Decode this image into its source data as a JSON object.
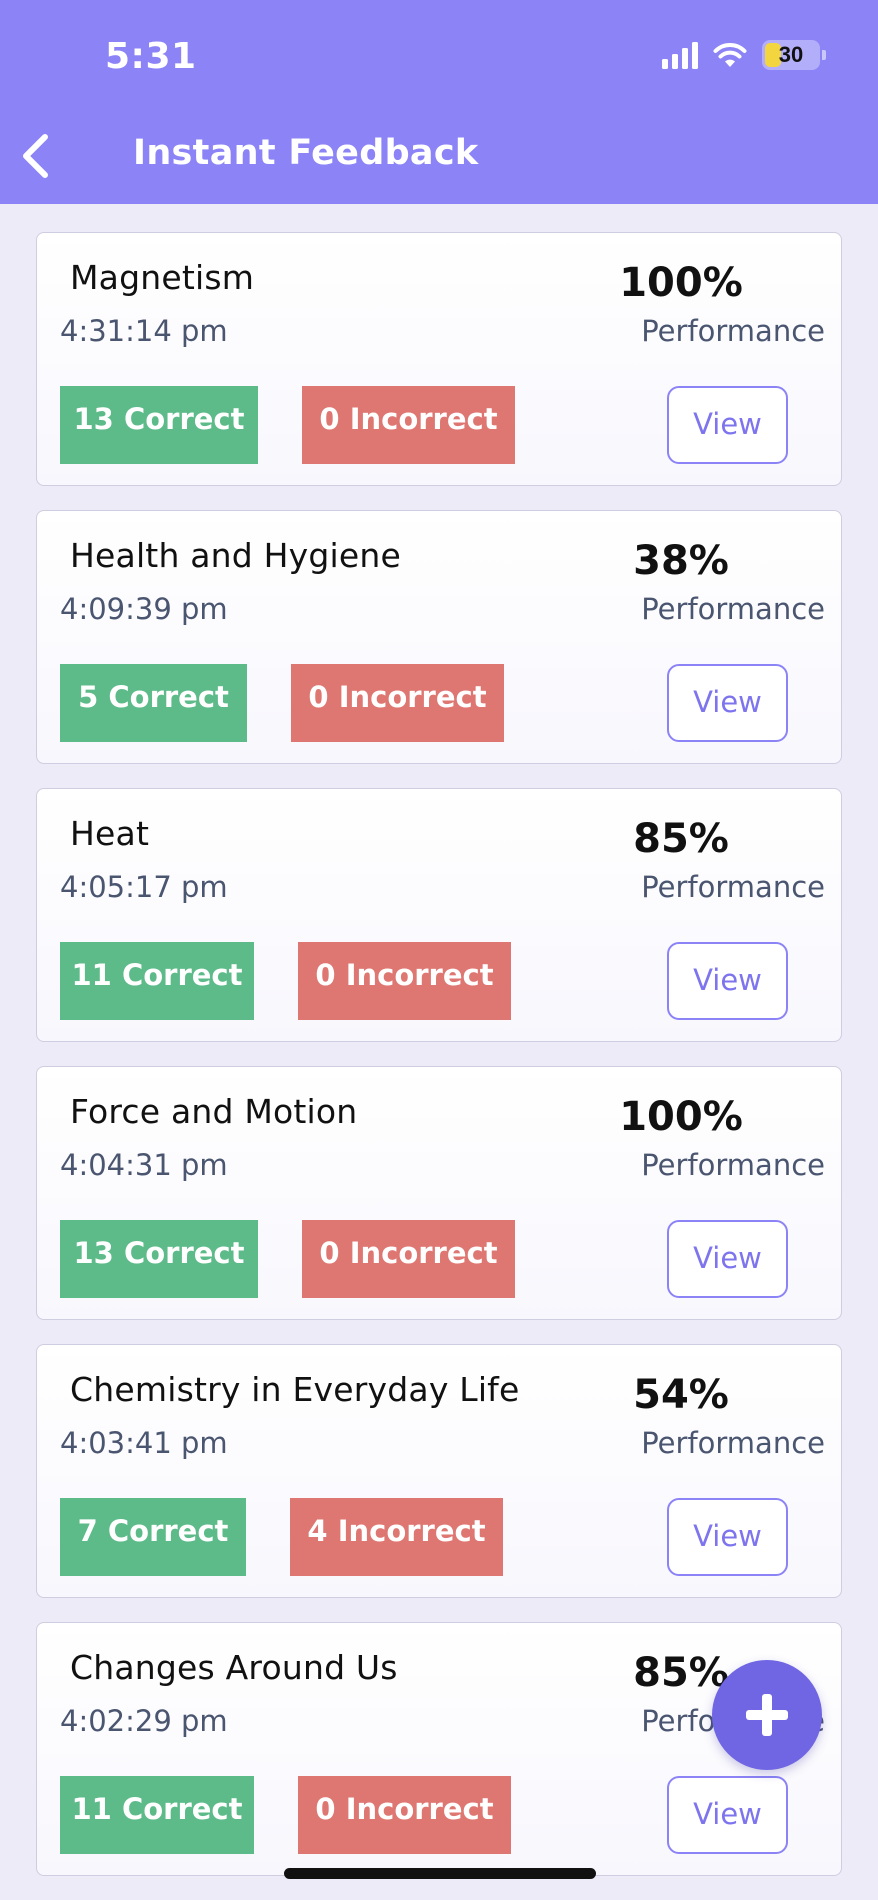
{
  "status_bar": {
    "time": "5:31",
    "battery": "30",
    "battery_fill": 0.3,
    "signal_icon": "cellular-signal-icon",
    "wifi_icon": "wifi-icon",
    "battery_icon": "battery-icon"
  },
  "header": {
    "title": "Instant Feedback",
    "back_icon": "chevron-left-icon",
    "background_color": "#8b83f6"
  },
  "colors": {
    "correct": "#5dbb8a",
    "incorrect": "#de7672",
    "accent": "#7066e3"
  },
  "results": [
    {
      "title": "Magnetism",
      "time": "4:31:14 pm",
      "percent": "100%",
      "performance_label": "Performance",
      "correct": "13 Correct",
      "incorrect": "0 Incorrect",
      "view_label": "View"
    },
    {
      "title": "Health and Hygiene",
      "time": "4:09:39 pm",
      "percent": "38%",
      "performance_label": "Performance",
      "correct": "5 Correct",
      "incorrect": "0 Incorrect",
      "view_label": "View"
    },
    {
      "title": "Heat",
      "time": "4:05:17 pm",
      "percent": "85%",
      "performance_label": "Performance",
      "correct": "11 Correct",
      "incorrect": "0 Incorrect",
      "view_label": "View"
    },
    {
      "title": "Force and Motion",
      "time": "4:04:31 pm",
      "percent": "100%",
      "performance_label": "Performance",
      "correct": "13 Correct",
      "incorrect": "0 Incorrect",
      "view_label": "View"
    },
    {
      "title": "Chemistry in Everyday Life",
      "time": "4:03:41 pm",
      "percent": "54%",
      "performance_label": "Performance",
      "correct": "7 Correct",
      "incorrect": "4 Incorrect",
      "view_label": "View"
    },
    {
      "title": "Changes Around Us",
      "time": "4:02:29 pm",
      "percent": "85%",
      "performance_label": "Performance",
      "correct": "11 Correct",
      "incorrect": "0 Incorrect",
      "view_label": "View"
    }
  ],
  "fab": {
    "icon": "plus-icon"
  }
}
